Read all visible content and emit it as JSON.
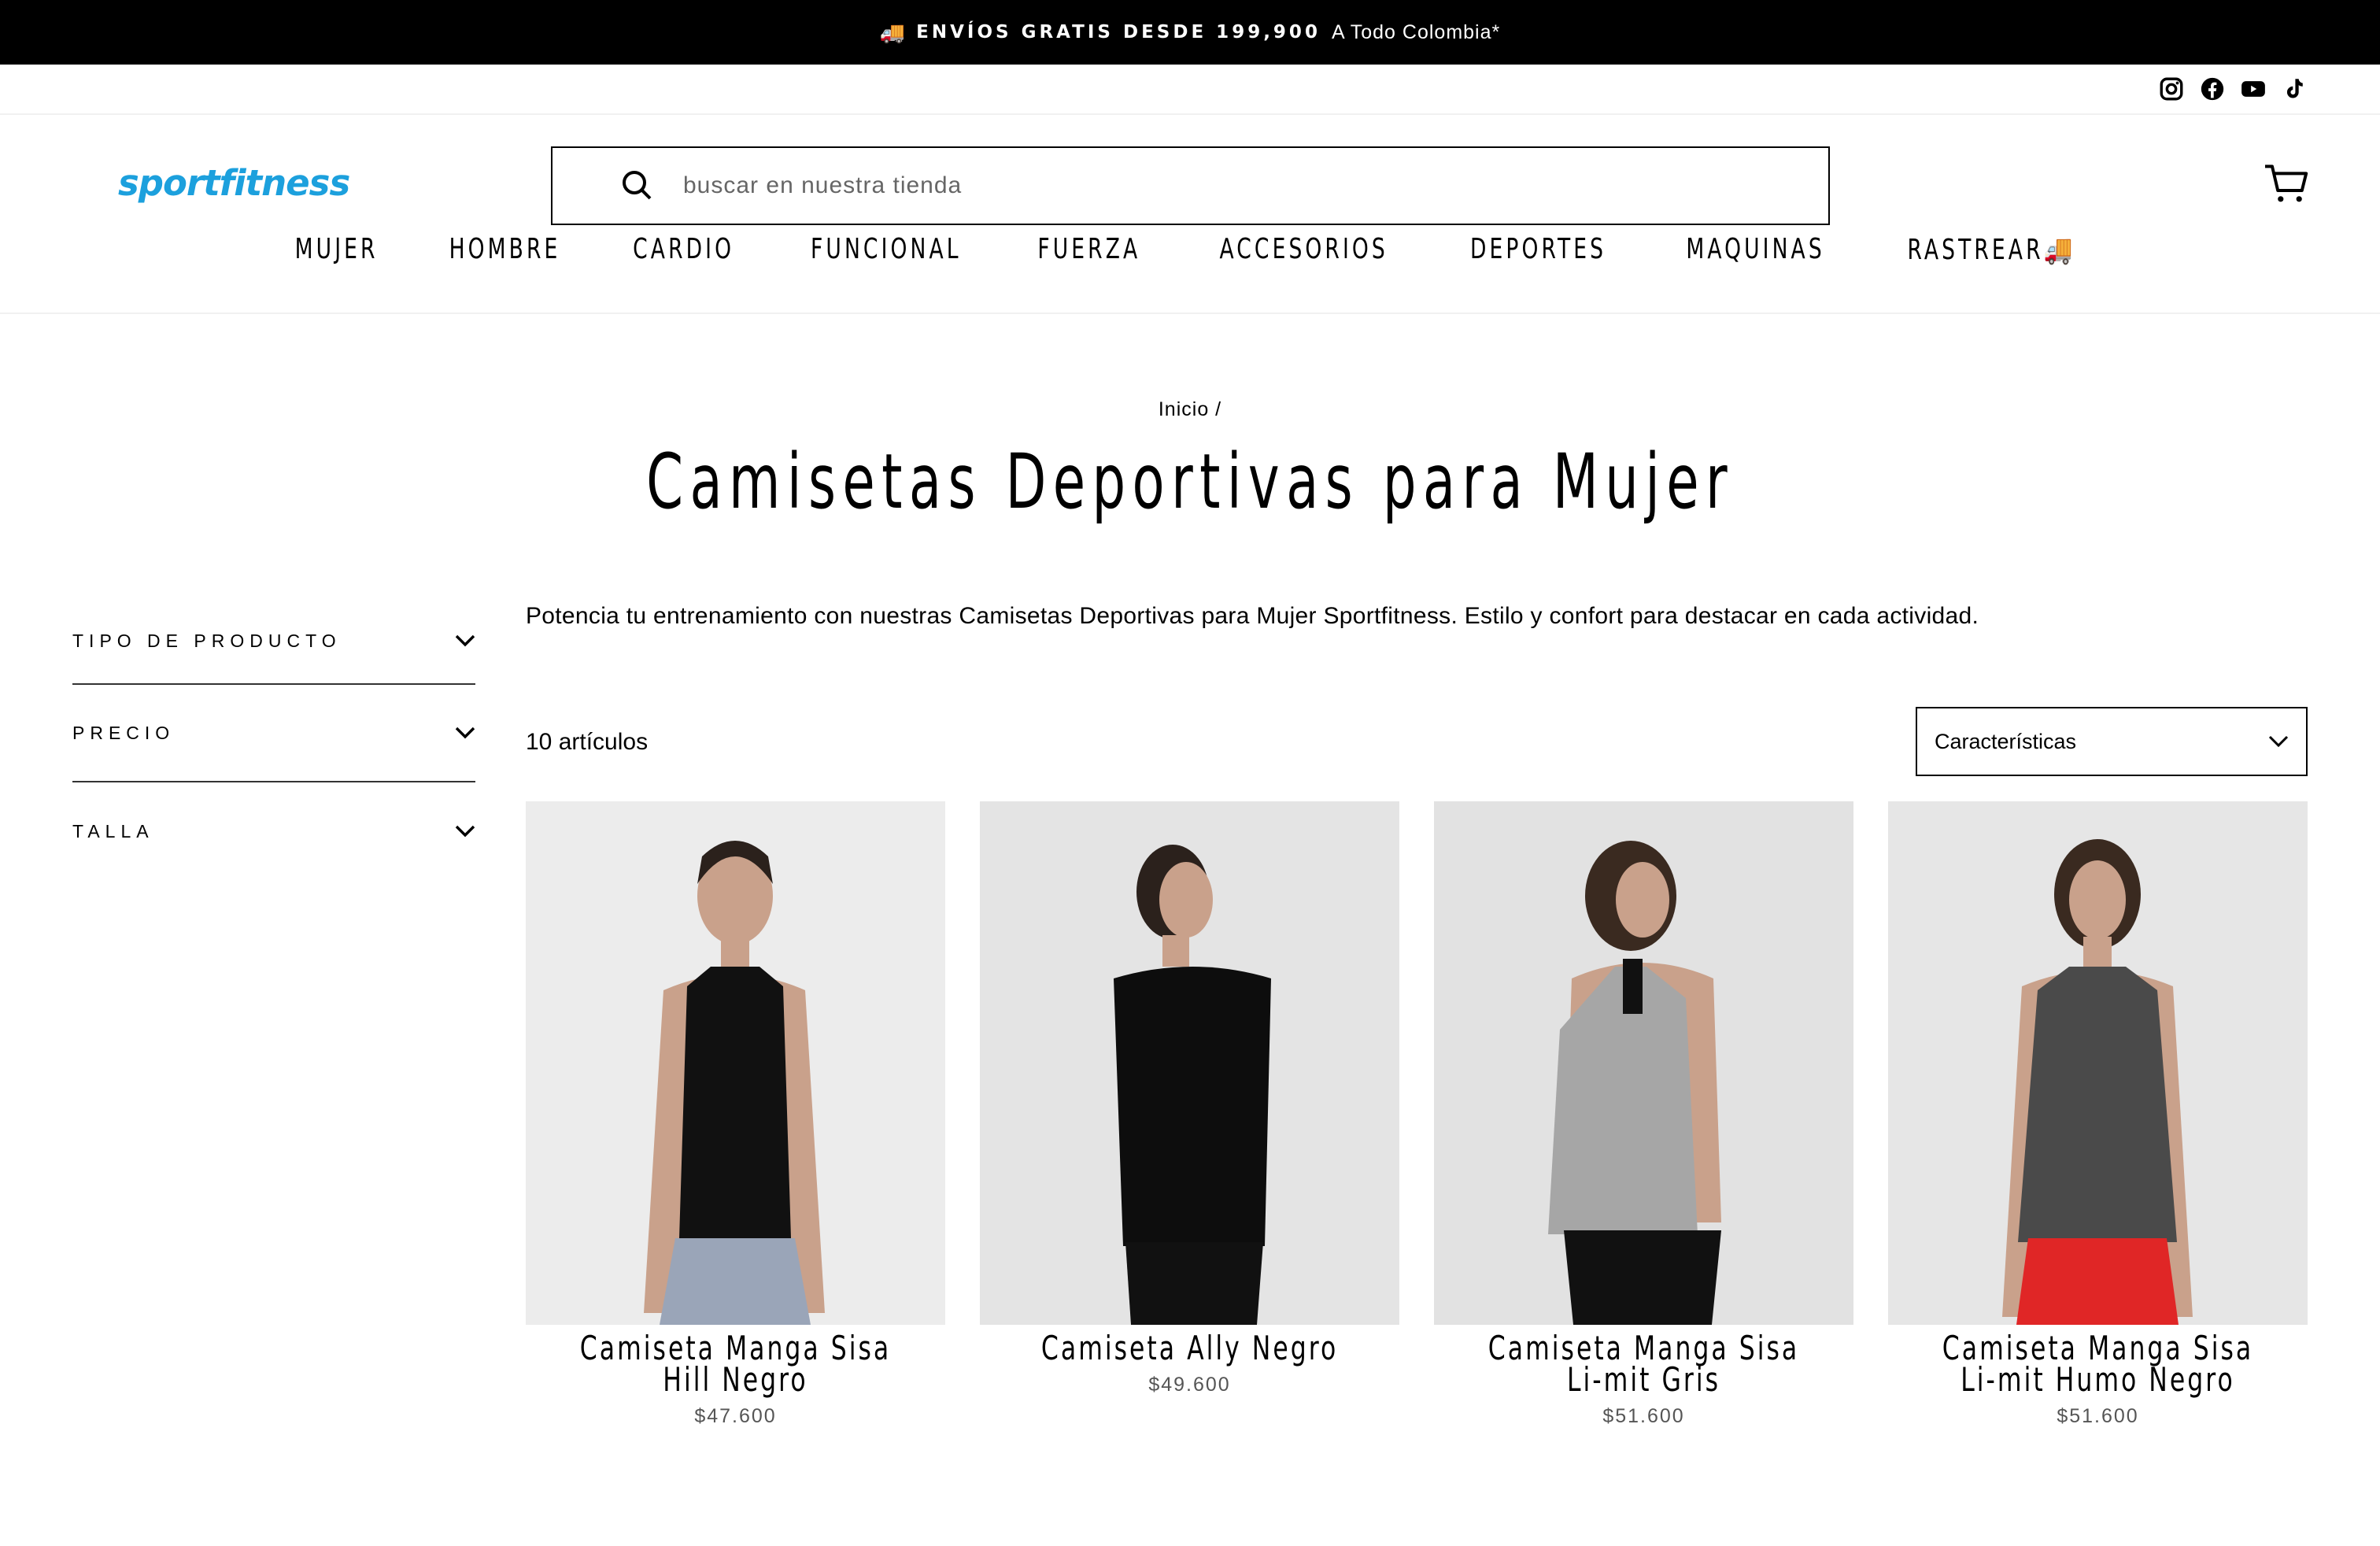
{
  "announcement": {
    "icon": "truck-icon",
    "bold": "ENVÍOS GRATIS DESDE 199,900",
    "light": "A Todo Colombia*"
  },
  "social": [
    "instagram-icon",
    "facebook-icon",
    "youtube-icon",
    "tiktok-icon"
  ],
  "logo": "sportfitness",
  "search": {
    "placeholder": "buscar en nuestra tienda"
  },
  "nav": [
    "MUJER",
    "HOMBRE",
    "CARDIO",
    "FUNCIONAL",
    "FUERZA",
    "ACCESORIOS",
    "DEPORTES",
    "MAQUINAS",
    "RASTREAR🚚"
  ],
  "breadcrumb": "Inicio /",
  "title": "Camisetas Deportivas para Mujer",
  "filters": [
    "TIPO DE PRODUCTO",
    "PRECIO",
    "TALLA"
  ],
  "description": "Potencia tu entrenamiento con nuestras Camisetas Deportivas para Mujer Sportfitness. Estilo y confort para destacar en cada actividad.",
  "count": "10 artículos",
  "sort": {
    "selected": "Características"
  },
  "products": [
    {
      "name": "Camiseta Manga Sisa Hill Negro",
      "price": "$47.600"
    },
    {
      "name": "Camiseta Ally Negro",
      "price": "$49.600"
    },
    {
      "name": "Camiseta Manga Sisa Li-mit Gris",
      "price": "$51.600"
    },
    {
      "name": "Camiseta Manga Sisa Li-mit Humo Negro",
      "price": "$51.600"
    }
  ],
  "colors": {
    "brand": "#1ca0dd",
    "announcement_bg": "#000000"
  }
}
